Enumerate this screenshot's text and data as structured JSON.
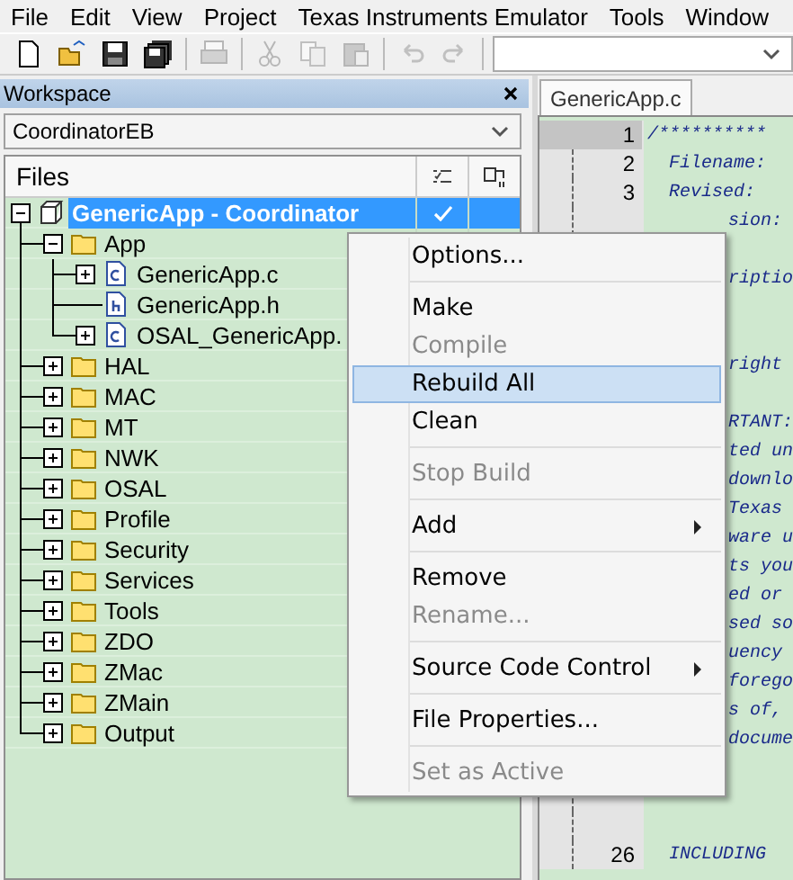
{
  "menu_bar": [
    "File",
    "Edit",
    "View",
    "Project",
    "Texas Instruments Emulator",
    "Tools",
    "Window"
  ],
  "toolbar": [
    {
      "kind": "new",
      "disabled": false
    },
    {
      "kind": "open",
      "disabled": false
    },
    {
      "kind": "save",
      "disabled": false
    },
    {
      "kind": "save-all",
      "disabled": false
    },
    {
      "kind": "separator"
    },
    {
      "kind": "print",
      "disabled": true
    },
    {
      "kind": "separator"
    },
    {
      "kind": "cut",
      "disabled": true
    },
    {
      "kind": "copy",
      "disabled": true
    },
    {
      "kind": "paste",
      "disabled": true
    },
    {
      "kind": "separator"
    },
    {
      "kind": "undo",
      "disabled": true
    },
    {
      "kind": "redo",
      "disabled": true
    },
    {
      "kind": "separator"
    },
    {
      "kind": "combo"
    }
  ],
  "workspace": {
    "title": "Workspace",
    "configuration": "CoordinatorEB",
    "header": "Files",
    "tree": [
      {
        "label": "GenericApp - Coordinator",
        "kind": "project",
        "expandable": true,
        "expanded": true,
        "selected": true,
        "checked": true,
        "children": [
          {
            "label": "App",
            "kind": "folder",
            "expandable": true,
            "expanded": true,
            "selected": false,
            "checked": false,
            "children": [
              {
                "label": "GenericApp.c",
                "kind": "c-file",
                "expandable": true,
                "expanded": false,
                "selected": false,
                "checked": false
              },
              {
                "label": "GenericApp.h",
                "kind": "h-file",
                "expandable": false,
                "selected": false,
                "checked": false
              },
              {
                "label": "OSAL_GenericApp.",
                "kind": "c-file",
                "expandable": true,
                "expanded": false,
                "selected": false,
                "checked": false
              }
            ]
          },
          {
            "label": "HAL",
            "kind": "folder",
            "expandable": true,
            "expanded": false,
            "selected": false,
            "checked": false
          },
          {
            "label": "MAC",
            "kind": "folder",
            "expandable": true,
            "expanded": false,
            "selected": false,
            "checked": false
          },
          {
            "label": "MT",
            "kind": "folder",
            "expandable": true,
            "expanded": false,
            "selected": false,
            "checked": false
          },
          {
            "label": "NWK",
            "kind": "folder",
            "expandable": true,
            "expanded": false,
            "selected": false,
            "checked": false
          },
          {
            "label": "OSAL",
            "kind": "folder",
            "expandable": true,
            "expanded": false,
            "selected": false,
            "checked": false
          },
          {
            "label": "Profile",
            "kind": "folder",
            "expandable": true,
            "expanded": false,
            "selected": false,
            "checked": false
          },
          {
            "label": "Security",
            "kind": "folder",
            "expandable": true,
            "expanded": false,
            "selected": false,
            "checked": false
          },
          {
            "label": "Services",
            "kind": "folder",
            "expandable": true,
            "expanded": false,
            "selected": false,
            "checked": false
          },
          {
            "label": "Tools",
            "kind": "folder",
            "expandable": true,
            "expanded": false,
            "selected": false,
            "checked": false
          },
          {
            "label": "ZDO",
            "kind": "folder",
            "expandable": true,
            "expanded": false,
            "selected": false,
            "checked": false
          },
          {
            "label": "ZMac",
            "kind": "folder",
            "expandable": true,
            "expanded": false,
            "selected": false,
            "checked": false
          },
          {
            "label": "ZMain",
            "kind": "folder",
            "expandable": true,
            "expanded": false,
            "selected": false,
            "checked": false
          },
          {
            "label": "Output",
            "kind": "folder",
            "expandable": true,
            "expanded": false,
            "selected": false,
            "checked": false
          }
        ]
      }
    ]
  },
  "editor": {
    "tab": "GenericApp.c",
    "lines": [
      {
        "kind": "code",
        "number": "1",
        "text": "/**********",
        "current": true
      },
      {
        "kind": "code",
        "number": "2",
        "text": "  Filename:",
        "current": false
      },
      {
        "kind": "code",
        "number": "3",
        "text": "  Revised:",
        "current": false
      },
      {
        "kind": "covered",
        "text": "sion:"
      },
      {
        "kind": "blank"
      },
      {
        "kind": "covered",
        "text": "riptio"
      },
      {
        "kind": "blank"
      },
      {
        "kind": "blank"
      },
      {
        "kind": "covered",
        "text": "right"
      },
      {
        "kind": "blank"
      },
      {
        "kind": "covered",
        "text": "RTANT:"
      },
      {
        "kind": "covered",
        "text": "ted un"
      },
      {
        "kind": "covered",
        "text": "downlo"
      },
      {
        "kind": "covered",
        "text": "Texas"
      },
      {
        "kind": "covered",
        "text": "ware u"
      },
      {
        "kind": "covered",
        "text": "ts you"
      },
      {
        "kind": "covered",
        "text": "ed or"
      },
      {
        "kind": "covered",
        "text": "sed so"
      },
      {
        "kind": "covered",
        "text": "uency"
      },
      {
        "kind": "covered",
        "text": "forego"
      },
      {
        "kind": "covered",
        "text": "s of,"
      },
      {
        "kind": "covered",
        "text": "docume"
      },
      {
        "kind": "blank"
      },
      {
        "kind": "blank"
      },
      {
        "kind": "blank"
      },
      {
        "kind": "code",
        "number": "26",
        "text": "  INCLUDING",
        "current": false
      }
    ]
  },
  "context_menu": [
    {
      "kind": "item",
      "label": "Options...",
      "disabled": false,
      "selected": false
    },
    {
      "kind": "separator"
    },
    {
      "kind": "item",
      "label": "Make",
      "disabled": false,
      "selected": false
    },
    {
      "kind": "item",
      "label": "Compile",
      "disabled": true,
      "selected": false
    },
    {
      "kind": "item",
      "label": "Rebuild All",
      "disabled": false,
      "selected": true
    },
    {
      "kind": "item",
      "label": "Clean",
      "disabled": false,
      "selected": false
    },
    {
      "kind": "separator"
    },
    {
      "kind": "item",
      "label": "Stop Build",
      "disabled": true,
      "selected": false
    },
    {
      "kind": "separator"
    },
    {
      "kind": "submenu",
      "label": "Add",
      "disabled": false,
      "selected": false
    },
    {
      "kind": "separator"
    },
    {
      "kind": "item",
      "label": "Remove",
      "disabled": false,
      "selected": false
    },
    {
      "kind": "item",
      "label": "Rename...",
      "disabled": true,
      "selected": false
    },
    {
      "kind": "separator"
    },
    {
      "kind": "submenu",
      "label": "Source Code Control",
      "disabled": false,
      "selected": false
    },
    {
      "kind": "separator"
    },
    {
      "kind": "item",
      "label": "File Properties...",
      "disabled": false,
      "selected": false
    },
    {
      "kind": "separator"
    },
    {
      "kind": "item",
      "label": "Set as Active",
      "disabled": true,
      "selected": false
    }
  ]
}
